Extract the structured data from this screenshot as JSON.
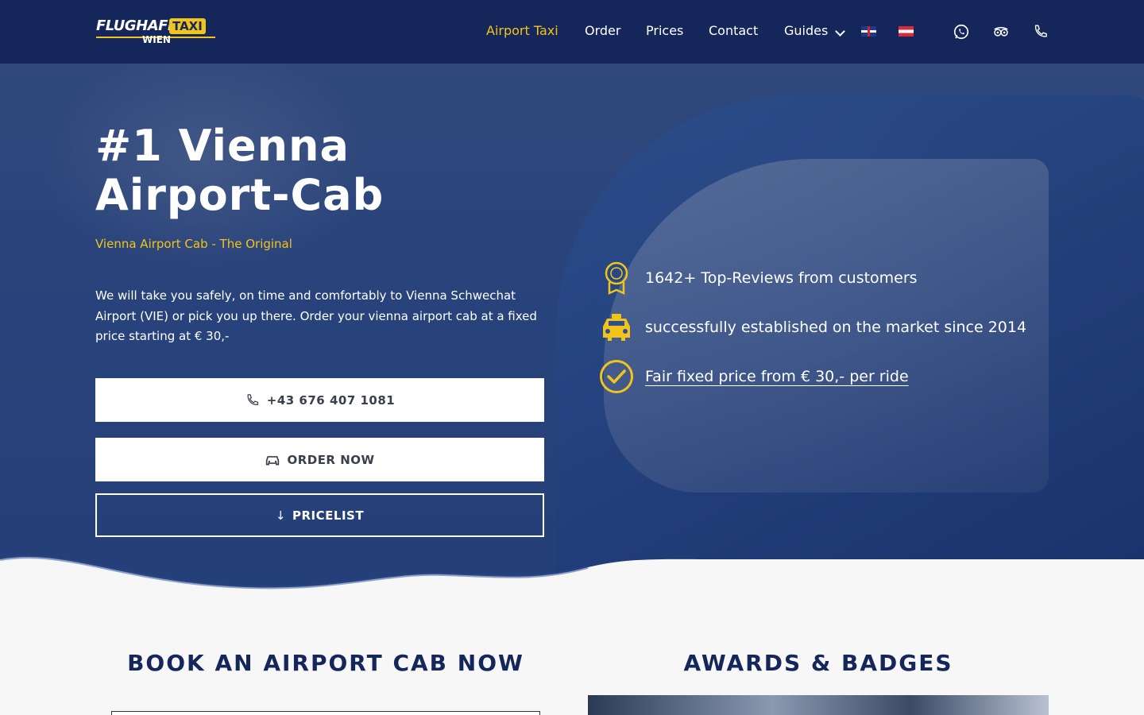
{
  "header": {
    "logo": {
      "word": "FLUGHAFEN",
      "badge": "TAXI",
      "city": "WIEN"
    },
    "nav": [
      {
        "label": "Airport Taxi",
        "active": true
      },
      {
        "label": "Order"
      },
      {
        "label": "Prices"
      },
      {
        "label": "Contact"
      },
      {
        "label": "Guides"
      }
    ],
    "languages": [
      "flag-uk-icon",
      "flag-austria-icon"
    ],
    "contact_icons": [
      "whatsapp-icon",
      "tripadvisor-icon",
      "phone-icon"
    ],
    "accent_color": "#f2c41a",
    "bg_color": "#15275a"
  },
  "hero": {
    "title": "#1 Vienna Airport-Cab",
    "subtitle": "Vienna Airport Cab - The Original",
    "text": "We will take you safely, on time and comfortably to Vienna Schwechat Airport (VIE) or pick you up there. Order your vienna airport cab at a fixed price starting at € 30,-",
    "buttons": {
      "phone": "+43 676 407 1081",
      "order": "ORDER NOW",
      "pricelist": "PRICELIST"
    },
    "features": [
      {
        "icon": "award-icon",
        "text": "1642+ Top-Reviews from customers"
      },
      {
        "icon": "taxi-icon",
        "text": "successfully established on the market since 2014"
      },
      {
        "icon": "check-circle-icon",
        "text": "Fair fixed price from € 30,- per ride"
      }
    ]
  },
  "sections": {
    "book_title": "BOOK AN AIRPORT CAB NOW",
    "awards_title": "AWARDS & BADGES"
  }
}
